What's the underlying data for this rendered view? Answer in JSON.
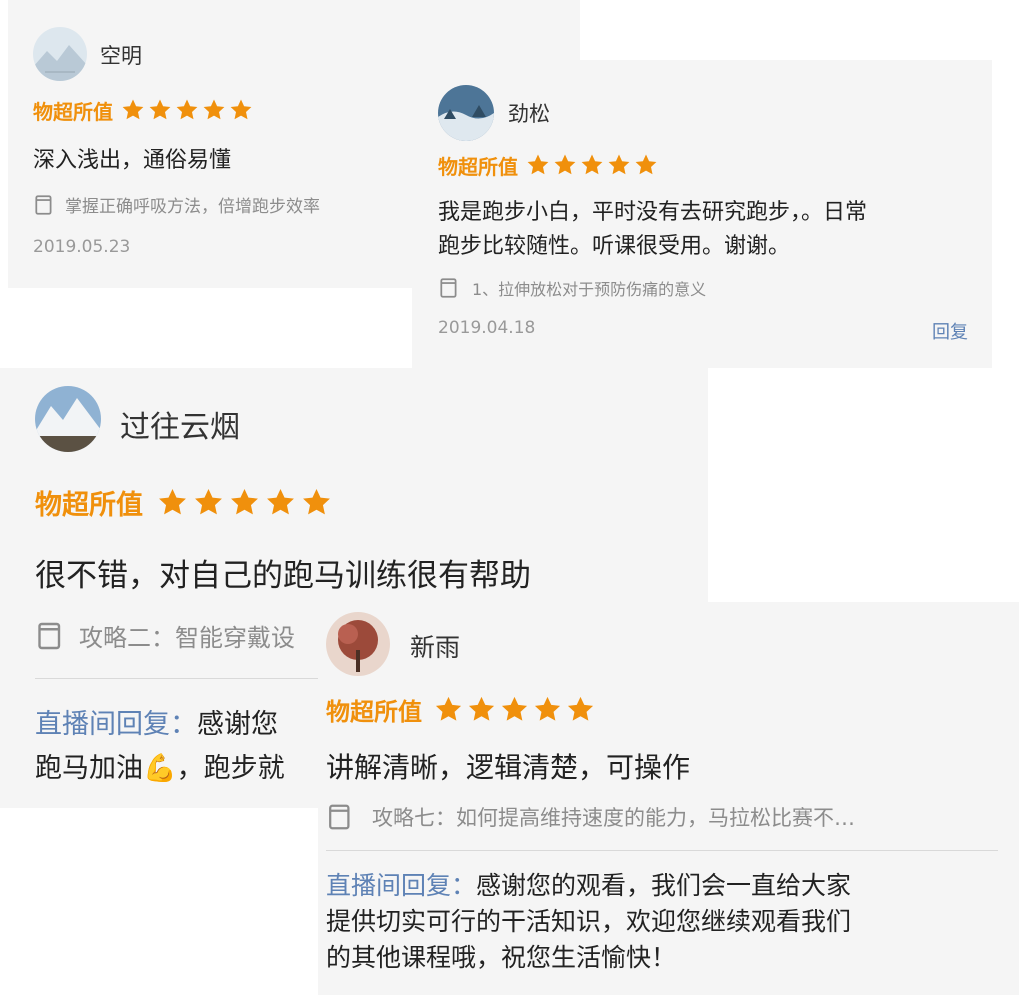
{
  "colors": {
    "card_bg": "#f5f5f5",
    "rating_orange": "#f0900c",
    "star_orange": "#f0900c",
    "reply_blue": "#5e82b5",
    "muted_gray": "#8c8c8c"
  },
  "reviews": [
    {
      "name": "空明",
      "rating_label": "物超所值",
      "rating": 5,
      "content": "深入浅出，通俗易懂",
      "lesson": "掌握正确呼吸方法，倍增跑步效率",
      "date": "2019.05.23"
    },
    {
      "name": "劲松",
      "rating_label": "物超所值",
      "rating": 5,
      "content_lines": [
        "我是跑步小白，平时没有去研究跑步，。日常",
        "跑步比较随性。听课很受用。谢谢。"
      ],
      "lesson": "1、拉伸放松对于预防伤痛的意义",
      "date": "2019.04.18",
      "reply_button": "回复"
    },
    {
      "name": "过往云烟",
      "rating_label": "物超所值",
      "rating": 5,
      "content": "很不错，对自己的跑马训练很有帮助",
      "lesson": "攻略二：智能穿戴设",
      "reply_label": "直播间回复：",
      "reply_lines": [
        "感谢您",
        "跑马加油💪，跑步就"
      ]
    },
    {
      "name": "新雨",
      "rating_label": "物超所值",
      "rating": 5,
      "content": "讲解清晰，逻辑清楚，可操作",
      "lesson": "攻略七：如何提高维持速度的能力，马拉松比赛不…",
      "reply_label": "直播间回复：",
      "reply_lines": [
        "感谢您的观看，我们会一直给大家",
        "提供切实可行的干活知识，欢迎您继续观看我们",
        "的其他课程哦，祝您生活愉快！"
      ]
    }
  ]
}
